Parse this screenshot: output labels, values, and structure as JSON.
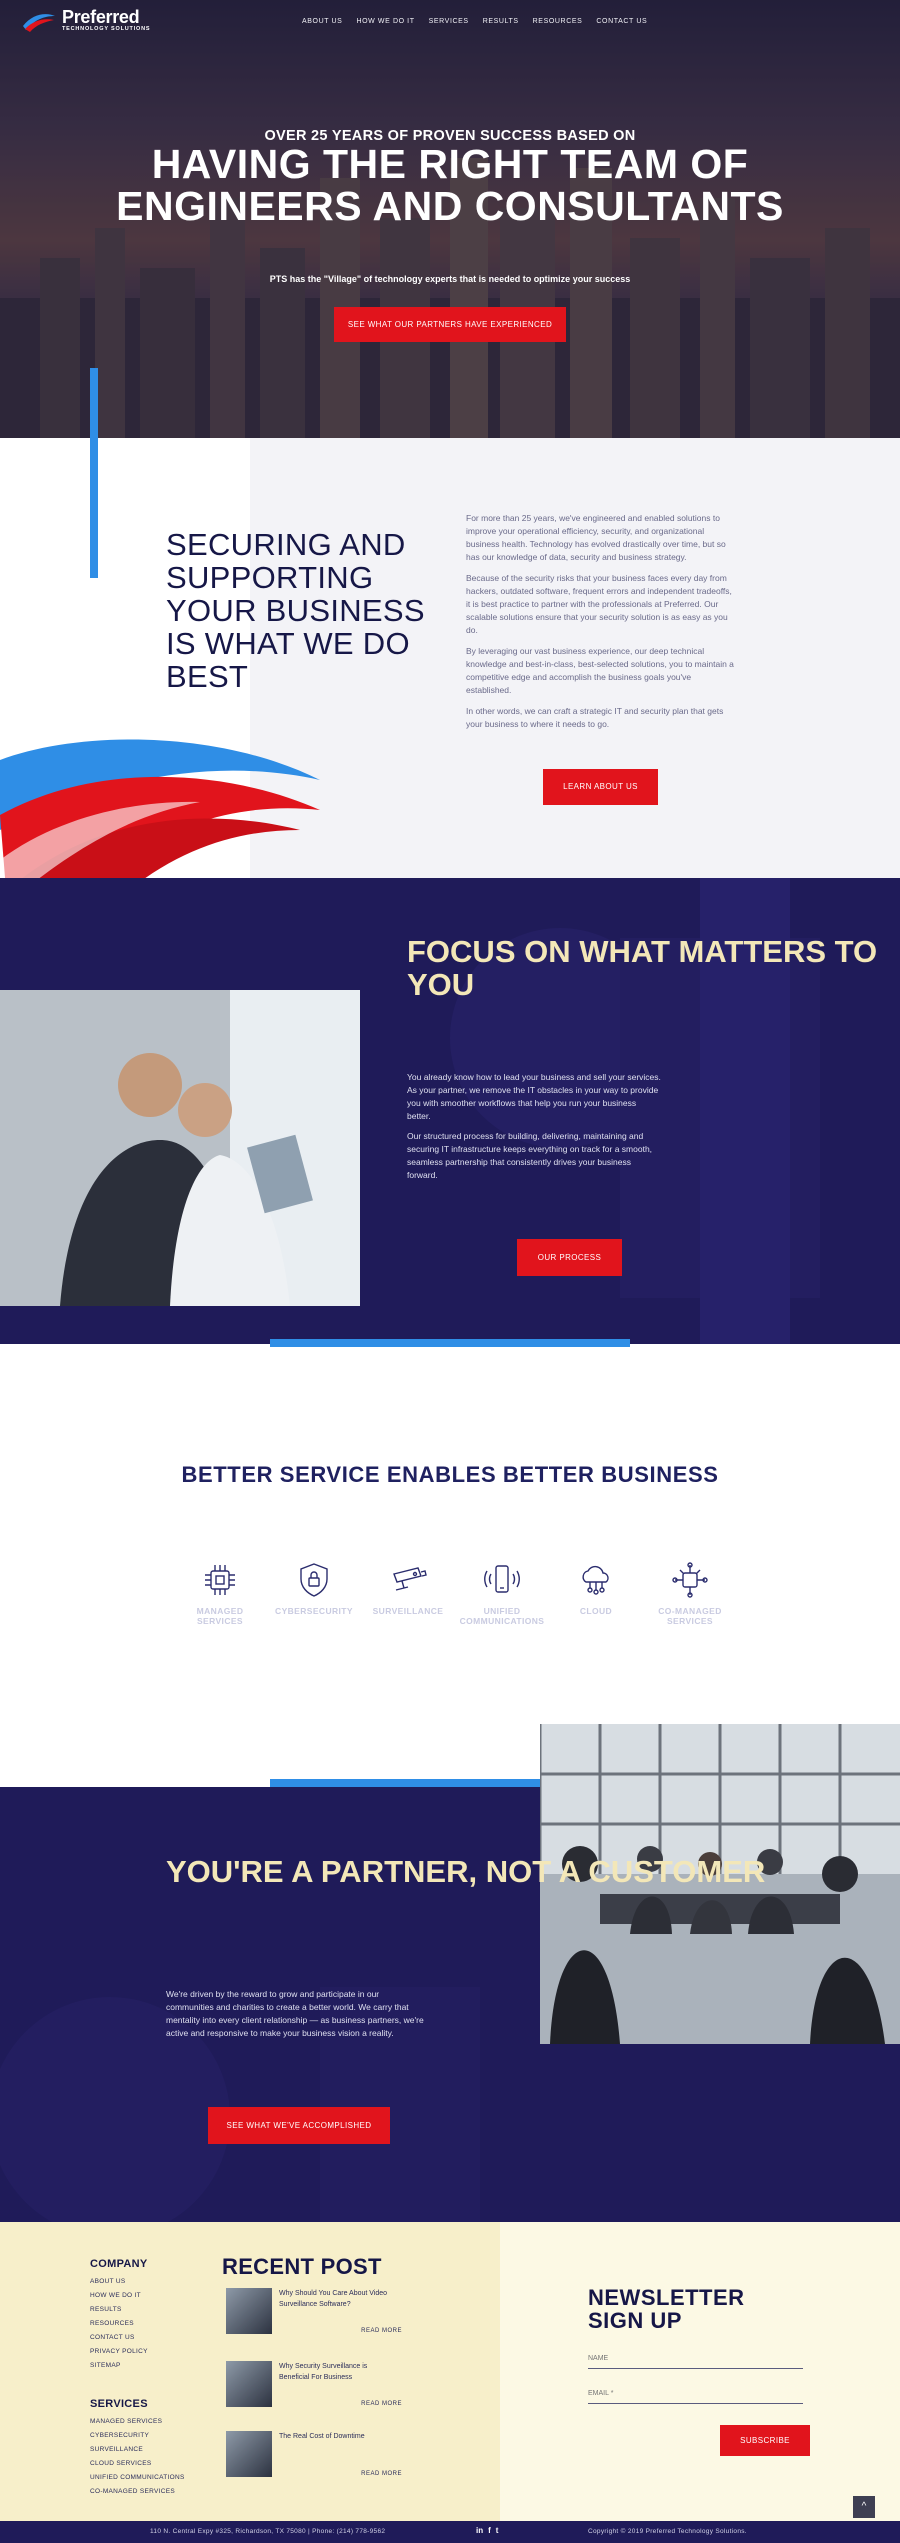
{
  "header": {
    "logo_name": "Preferred",
    "logo_tagline": "TECHNOLOGY SOLUTIONS",
    "nav": [
      "ABOUT US",
      "HOW WE DO IT",
      "SERVICES",
      "RESULTS",
      "RESOURCES",
      "CONTACT US"
    ]
  },
  "hero": {
    "kicker": "OVER 25 YEARS OF PROVEN SUCCESS BASED ON",
    "title": "HAVING THE RIGHT TEAM OF ENGINEERS AND CONSULTANTS",
    "subtitle": "PTS has the \"Village\" of technology experts that is needed to optimize your success",
    "button": "SEE WHAT OUR PARTNERS HAVE EXPERIENCED"
  },
  "securing": {
    "title": "SECURING AND SUPPORTING YOUR BUSINESS IS WHAT WE DO BEST",
    "paragraphs": [
      "For more than 25 years, we've engineered and enabled solutions to improve your operational efficiency, security, and organizational business health. Technology has evolved drastically over time, but so has our knowledge of data, security and business strategy.",
      "Because of the security risks that your business faces every day from hackers, outdated software, frequent errors and independent tradeoffs, it is best practice to partner with the professionals at Preferred. Our scalable solutions ensure that your security solution is as easy as you do.",
      "By leveraging our vast business experience, our deep technical knowledge and best-in-class, best-selected solutions, you to maintain a competitive edge and accomplish the business goals you've established.",
      "In other words, we can craft a strategic IT and security plan that gets your business to where it needs to go."
    ],
    "button": "LEARN ABOUT US"
  },
  "focus": {
    "title": "FOCUS ON WHAT MATTERS TO YOU",
    "paragraphs": [
      "You already know how to lead your business and sell your services. As your partner, we remove the IT obstacles in your way to provide you with smoother workflows that help you run your business better.",
      "Our structured process for building, delivering, maintaining and securing IT infrastructure keeps everything on track for a smooth, seamless partnership that consistently drives your business forward."
    ],
    "button": "OUR PROCESS"
  },
  "services": {
    "title": "BETTER SERVICE ENABLES BETTER BUSINESS",
    "items": [
      {
        "label": "MANAGED SERVICES",
        "icon": "chip-icon"
      },
      {
        "label": "CYBERSECURITY",
        "icon": "shield-lock-icon"
      },
      {
        "label": "SURVEILLANCE",
        "icon": "camera-icon"
      },
      {
        "label": "UNIFIED COMMUNICATIONS",
        "icon": "phone-icon"
      },
      {
        "label": "CLOUD",
        "icon": "cloud-icon"
      },
      {
        "label": "CO-MANAGED SERVICES",
        "icon": "network-icon"
      }
    ]
  },
  "partner": {
    "title": "YOU'RE A PARTNER, NOT A CUSTOMER",
    "text": "We're driven by the reward to grow and participate in our communities and charities to create a better world. We carry that mentality into every client relationship — as business partners, we're active and responsive to make your business vision a reality.",
    "button": "SEE WHAT WE'VE ACCOMPLISHED"
  },
  "footer": {
    "company_heading": "COMPANY",
    "company_links": [
      "ABOUT US",
      "HOW WE DO IT",
      "RESULTS",
      "RESOURCES",
      "CONTACT US",
      "PRIVACY POLICY",
      "SITEMAP"
    ],
    "services_heading": "SERVICES",
    "services_links": [
      "MANAGED SERVICES",
      "CYBERSECURITY",
      "SURVEILLANCE",
      "CLOUD SERVICES",
      "UNIFIED COMMUNICATIONS",
      "CO-MANAGED SERVICES"
    ],
    "recent_heading": "RECENT POST",
    "posts": [
      {
        "title": "Why Should You Care About Video Surveillance Software?",
        "more": "READ MORE"
      },
      {
        "title": "Why Security Surveillance is Beneficial For Business",
        "more": "READ MORE"
      },
      {
        "title": "The Real Cost of Downtime",
        "more": "READ MORE"
      }
    ],
    "newsletter_heading": "NEWSLETTER SIGN UP",
    "name_placeholder": "NAME",
    "email_placeholder": "EMAIL *",
    "subscribe": "SUBSCRIBE",
    "address": "110 N. Central Expy #325, Richardson, TX 75080   |   Phone: (214) 778-9562",
    "social": [
      "in",
      "f",
      "t"
    ],
    "copyright": "Copyright © 2019 Preferred Technology Solutions.",
    "to_top": "^"
  },
  "colors": {
    "navy": "#1f1b59",
    "red": "#e1141c",
    "blue": "#2f8ee6",
    "cream": "#f3e7b8"
  }
}
